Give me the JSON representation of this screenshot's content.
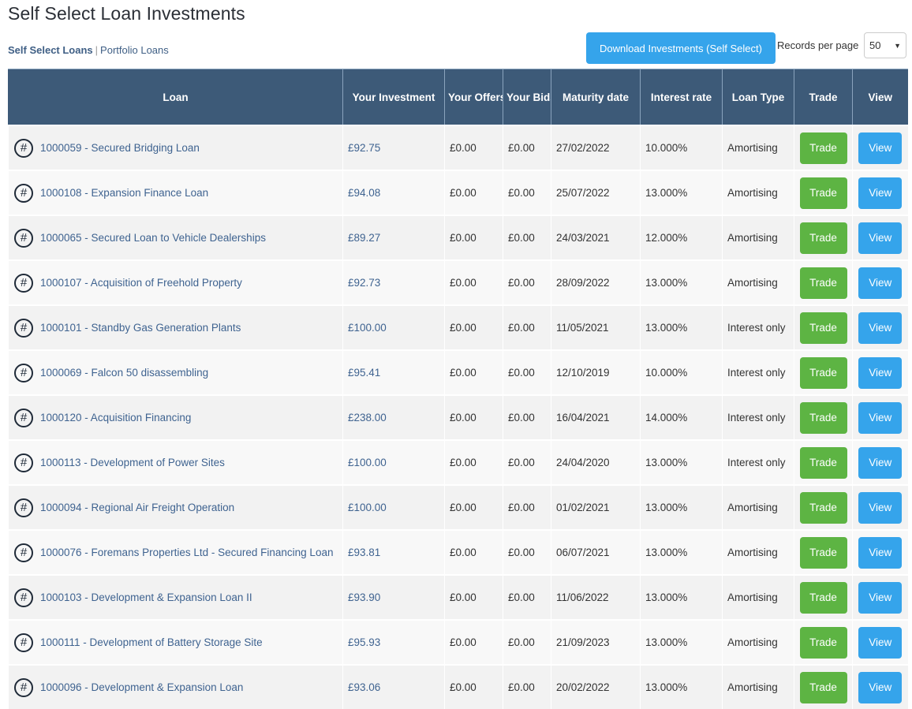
{
  "page": {
    "title": "Self Select Loan Investments"
  },
  "subnav": {
    "items": [
      {
        "label": "Self Select Loans",
        "active": true
      },
      {
        "label": "Portfolio Loans",
        "active": false
      }
    ],
    "separator": "|"
  },
  "toolbar": {
    "download_label": "Download Investments (Self Select)",
    "records_per_page_label": "Records per page",
    "records_per_page_value": "50",
    "dropdown_arrow": "▼"
  },
  "table": {
    "headers": [
      "Loan",
      "Your Investment",
      "Your Offers",
      "Your Bids",
      "Maturity date",
      "Interest rate",
      "Loan Type",
      "Trade",
      "View"
    ],
    "row_icon": "#",
    "trade_label": "Trade",
    "view_label": "View",
    "rows": [
      {
        "loan": "1000059 - Secured Bridging Loan",
        "investment": "£92.75",
        "offers": "£0.00",
        "bids": "£0.00",
        "maturity": "27/02/2022",
        "rate": "10.000%",
        "type": "Amortising"
      },
      {
        "loan": "1000108 - Expansion Finance Loan",
        "investment": "£94.08",
        "offers": "£0.00",
        "bids": "£0.00",
        "maturity": "25/07/2022",
        "rate": "13.000%",
        "type": "Amortising"
      },
      {
        "loan": "1000065 - Secured Loan to Vehicle Dealerships",
        "investment": "£89.27",
        "offers": "£0.00",
        "bids": "£0.00",
        "maturity": "24/03/2021",
        "rate": "12.000%",
        "type": "Amortising"
      },
      {
        "loan": "1000107 - Acquisition of Freehold Property",
        "investment": "£92.73",
        "offers": "£0.00",
        "bids": "£0.00",
        "maturity": "28/09/2022",
        "rate": "13.000%",
        "type": "Amortising"
      },
      {
        "loan": "1000101 - Standby Gas Generation Plants",
        "investment": "£100.00",
        "offers": "£0.00",
        "bids": "£0.00",
        "maturity": "11/05/2021",
        "rate": "13.000%",
        "type": "Interest only"
      },
      {
        "loan": "1000069 - Falcon 50 disassembling",
        "investment": "£95.41",
        "offers": "£0.00",
        "bids": "£0.00",
        "maturity": "12/10/2019",
        "rate": "10.000%",
        "type": "Interest only"
      },
      {
        "loan": "1000120 - Acquisition Financing",
        "investment": "£238.00",
        "offers": "£0.00",
        "bids": "£0.00",
        "maturity": "16/04/2021",
        "rate": "14.000%",
        "type": "Interest only"
      },
      {
        "loan": "1000113 - Development of Power Sites",
        "investment": "£100.00",
        "offers": "£0.00",
        "bids": "£0.00",
        "maturity": "24/04/2020",
        "rate": "13.000%",
        "type": "Interest only"
      },
      {
        "loan": "1000094 - Regional Air Freight Operation",
        "investment": "£100.00",
        "offers": "£0.00",
        "bids": "£0.00",
        "maturity": "01/02/2021",
        "rate": "13.000%",
        "type": "Amortising"
      },
      {
        "loan": "1000076 - Foremans Properties Ltd - Secured Financing Loan",
        "investment": "£93.81",
        "offers": "£0.00",
        "bids": "£0.00",
        "maturity": "06/07/2021",
        "rate": "13.000%",
        "type": "Amortising"
      },
      {
        "loan": "1000103 - Development & Expansion Loan II",
        "investment": "£93.90",
        "offers": "£0.00",
        "bids": "£0.00",
        "maturity": "11/06/2022",
        "rate": "13.000%",
        "type": "Amortising"
      },
      {
        "loan": "1000111 - Development of Battery Storage Site",
        "investment": "£95.93",
        "offers": "£0.00",
        "bids": "£0.00",
        "maturity": "21/09/2023",
        "rate": "13.000%",
        "type": "Amortising"
      },
      {
        "loan": "1000096 - Development & Expansion Loan",
        "investment": "£93.06",
        "offers": "£0.00",
        "bids": "£0.00",
        "maturity": "20/02/2022",
        "rate": "13.000%",
        "type": "Amortising"
      }
    ]
  },
  "colors": {
    "header_bg": "#3d5a78",
    "trade_button": "#5db443",
    "view_button": "#35a4eb",
    "link": "#3f6390"
  }
}
